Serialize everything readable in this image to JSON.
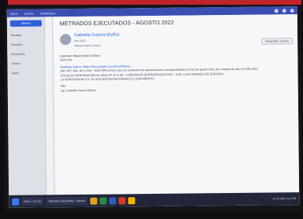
{
  "topbar": {
    "items": [
      "Inbox",
      "Correo",
      "Calendario"
    ]
  },
  "sidebar": {
    "new_button": "Nuevo",
    "items": [
      {
        "label": "Bandeja",
        "count": ""
      },
      {
        "label": "Enviados",
        "count": ""
      },
      {
        "label": "Borradores",
        "count": ""
      },
      {
        "label": "Archivo",
        "count": ""
      },
      {
        "label": "Spam",
        "count": ""
      }
    ]
  },
  "message": {
    "subject": "METRADOS EJECUTADOS - AGOSTO 2022",
    "sender_name": "Gabriela Guerra Muñoz",
    "date": "Sep 2022",
    "to": "Miguel Angel Canepa",
    "reply_label": "Responder a todos",
    "greeting": "Ingeniero Miguel Ángel Canepa",
    "salutation": "Buen día,",
    "paragraph_1": "Mediante enlace: https://drive.google.com/drive/folders/...",
    "paragraph_2": "360, 407, 364, 407 y 994 - 2022-MPCCHS-O que se remitieron las valorizaciones correspondientes al mes de agosto 2022 del contrato de obra 07-028-2022.",
    "paragraph_3": "EFICACIA CORPORACIÓN de Obras M° 01 al 08 - CONSORCIO INTERVENCIÓN CIVIL - CHS, CON ÓRDENES DE SERVICIO",
    "paragraph_4": "LA SUPERVISIÓN S.A. SE ENCUENTRA REVISANDO EL DOCUMENTO.",
    "closing": "Atte.",
    "signature": "Ing. Gabriela Guerra Muñoz"
  },
  "taskbar": {
    "tabs": [
      "Inbox - Correo",
      "Metrados ejecutados - agosto"
    ],
    "tray": "24°C  ESP  4:41 PM"
  }
}
